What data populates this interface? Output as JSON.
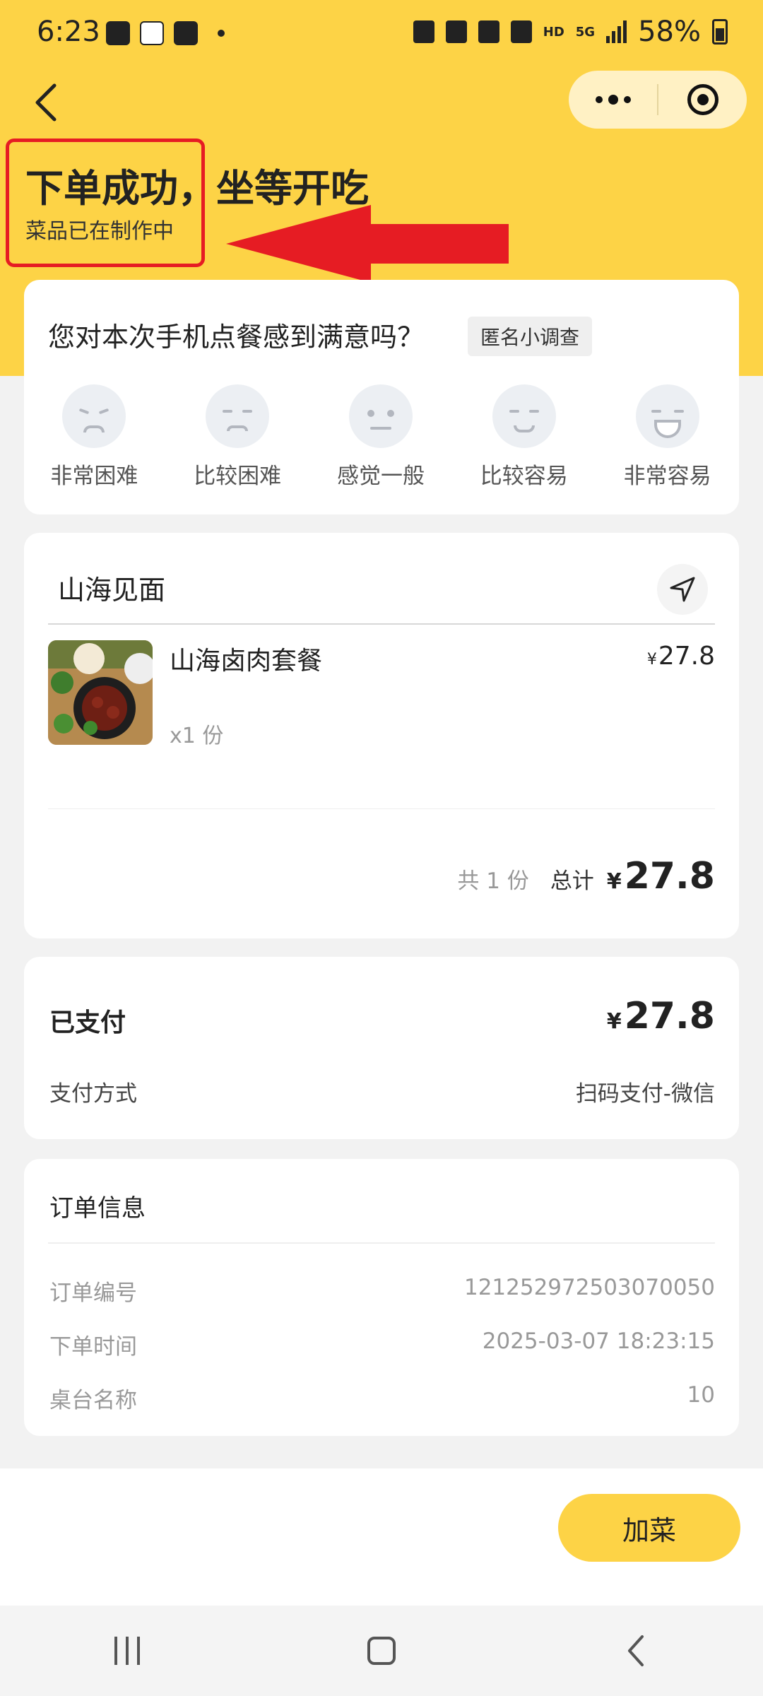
{
  "status_bar": {
    "time": "6:23",
    "battery": "58%",
    "network_badge": "5G",
    "hd_badge": "HD"
  },
  "header": {
    "title": "下单成功，坐等开吃",
    "subtitle": "菜品已在制作中"
  },
  "survey": {
    "question": "您对本次手机点餐感到满意吗？",
    "tag": "匿名小调查",
    "options": [
      {
        "label": "非常困难",
        "icon": "very-hard-face-icon"
      },
      {
        "label": "比较困难",
        "icon": "hard-face-icon"
      },
      {
        "label": "感觉一般",
        "icon": "neutral-face-icon"
      },
      {
        "label": "比较容易",
        "icon": "easy-face-icon"
      },
      {
        "label": "非常容易",
        "icon": "very-easy-face-icon"
      }
    ]
  },
  "order": {
    "shop_name": "山海见面",
    "items": [
      {
        "name": "山海卤肉套餐",
        "price": "27.8",
        "qty": "x1 份"
      }
    ],
    "total_count": "共 1 份",
    "total_label": "总计",
    "total_amount": "27.8",
    "currency": "¥"
  },
  "payment": {
    "status": "已支付",
    "amount": "27.8",
    "method_label": "支付方式",
    "method_value": "扫码支付-微信"
  },
  "order_info": {
    "title": "订单信息",
    "rows": [
      {
        "label": "订单编号",
        "value": "121252972503070050"
      },
      {
        "label": "下单时间",
        "value": "2025-03-07 18:23:15"
      },
      {
        "label": "桌台名称",
        "value": "10"
      }
    ]
  },
  "actions": {
    "add_dish": "加菜"
  },
  "colors": {
    "brand_yellow": "#fdd346",
    "annotation_red": "#e61c23"
  }
}
